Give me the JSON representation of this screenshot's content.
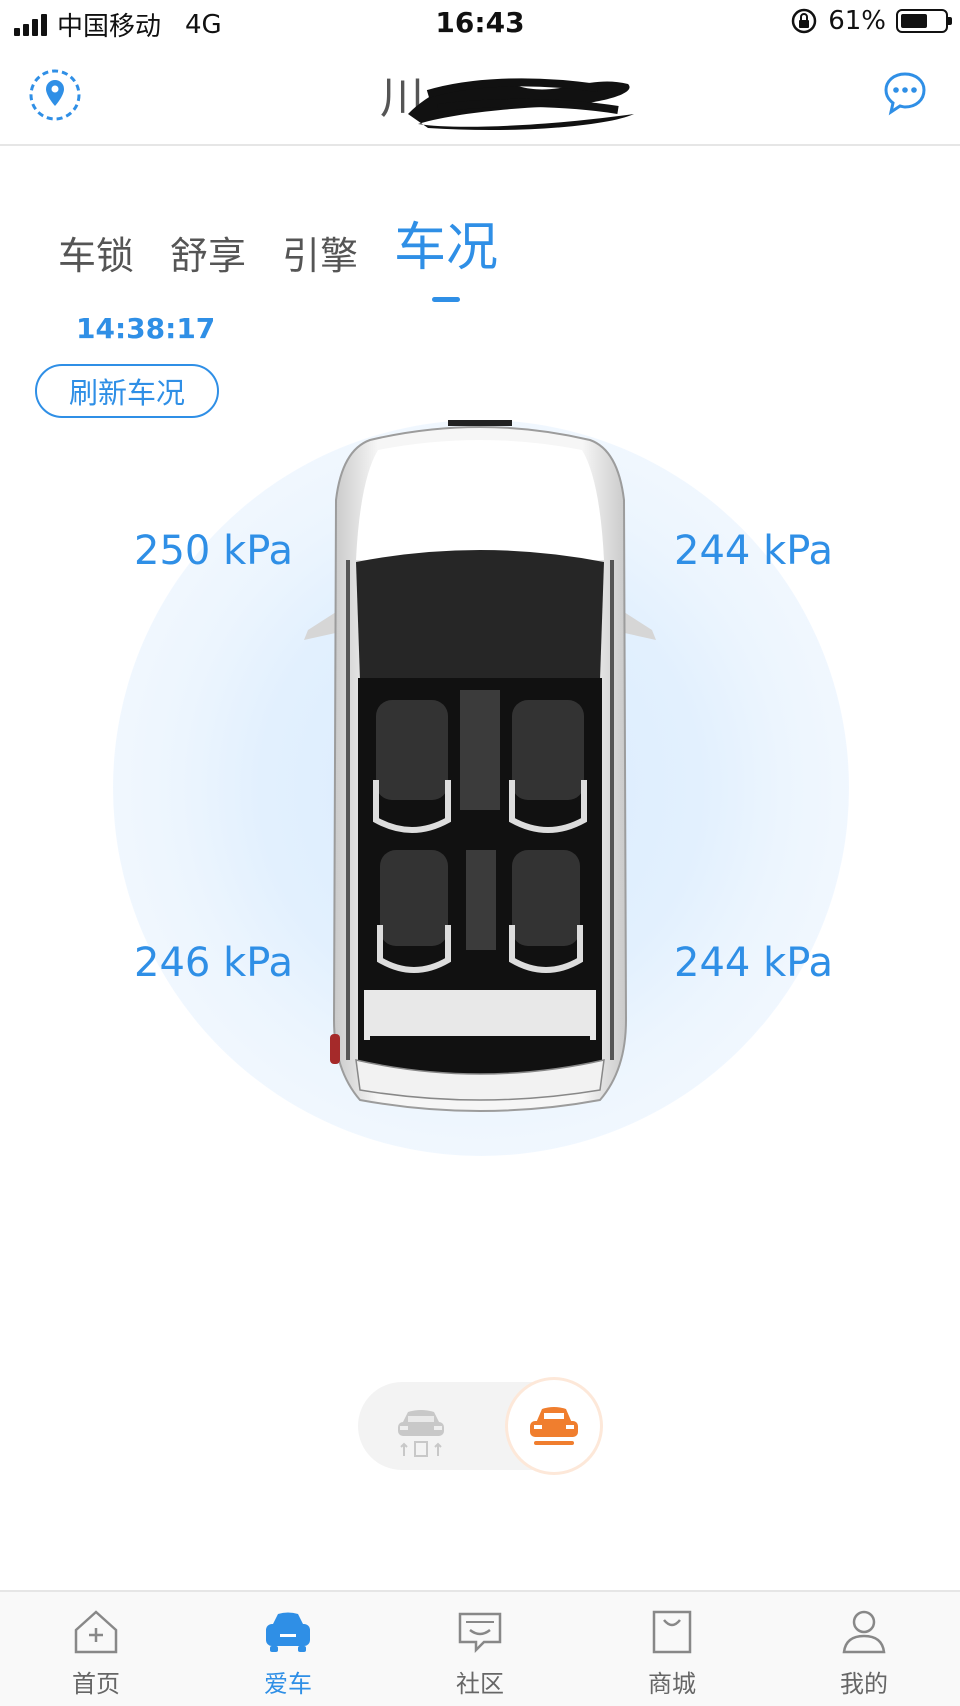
{
  "status_bar": {
    "carrier": "中国移动",
    "network": "4G",
    "time": "16:43",
    "battery": "61%",
    "battery_level": 0.61
  },
  "header": {
    "plate_visible": "川",
    "left_icon": "location-pin-icon",
    "right_icon": "chat-bubble-icon"
  },
  "tabs": [
    {
      "label": "车锁",
      "active": false
    },
    {
      "label": "舒享",
      "active": false
    },
    {
      "label": "引擎",
      "active": false
    },
    {
      "label": "车况",
      "active": true
    }
  ],
  "status": {
    "timestamp": "14:38:17",
    "refresh_label": "刷新车况"
  },
  "tires": {
    "front_left": "250 kPa",
    "front_right": "244 kPa",
    "rear_left": "246 kPa",
    "rear_right": "244 kPa"
  },
  "view_toggle": {
    "left_icon": "car-top-view-icon",
    "right_icon": "car-front-icon"
  },
  "colors": {
    "accent": "#2f8fe6",
    "toggle_active": "#f07e2e"
  },
  "bottom_nav": [
    {
      "label": "首页",
      "icon": "home-icon",
      "active": false
    },
    {
      "label": "爱车",
      "icon": "car-icon",
      "active": true
    },
    {
      "label": "社区",
      "icon": "community-icon",
      "active": false
    },
    {
      "label": "商城",
      "icon": "shop-bag-icon",
      "active": false
    },
    {
      "label": "我的",
      "icon": "profile-icon",
      "active": false
    }
  ]
}
